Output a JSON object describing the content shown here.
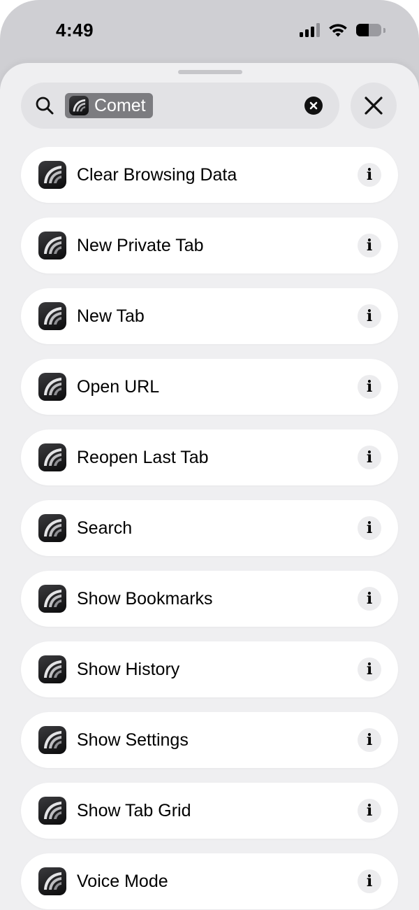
{
  "status_bar": {
    "time": "4:49",
    "battery_level": 0.5
  },
  "search": {
    "token_label": "Comet",
    "search_icon": "magnifying-glass-icon",
    "clear_icon": "x-circle-fill-icon",
    "close_icon": "close-icon"
  },
  "app_icon": "comet-app-icon",
  "info_icon": "info-icon",
  "info_label": "i",
  "actions": [
    {
      "label": "Clear Browsing Data"
    },
    {
      "label": "New Private Tab"
    },
    {
      "label": "New Tab"
    },
    {
      "label": "Open URL"
    },
    {
      "label": "Reopen Last Tab"
    },
    {
      "label": "Search"
    },
    {
      "label": "Show Bookmarks"
    },
    {
      "label": "Show History"
    },
    {
      "label": "Show Settings"
    },
    {
      "label": "Show Tab Grid"
    },
    {
      "label": "Voice Mode"
    }
  ],
  "colors": {
    "sheet_background": "#efeff1",
    "row_background": "#ffffff",
    "token_background": "#7c7c80"
  }
}
